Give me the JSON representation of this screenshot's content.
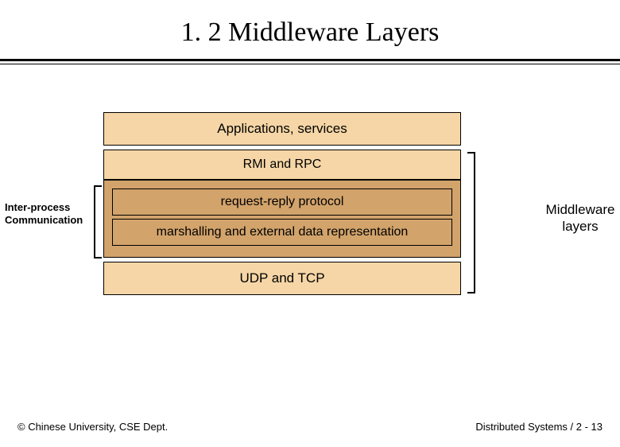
{
  "title": "1. 2 Middleware Layers",
  "left_label": "Inter-process Communication",
  "right_label": "Middleware layers",
  "layers": {
    "top": "Applications, services",
    "rmi_rpc": "RMI and RPC",
    "request_reply": "request-reply protocol",
    "marshalling": "marshalling and external data representation",
    "bottom": "UDP and TCP"
  },
  "footer": {
    "left": "© Chinese University, CSE Dept.",
    "right": "Distributed Systems / 2 - 13"
  }
}
